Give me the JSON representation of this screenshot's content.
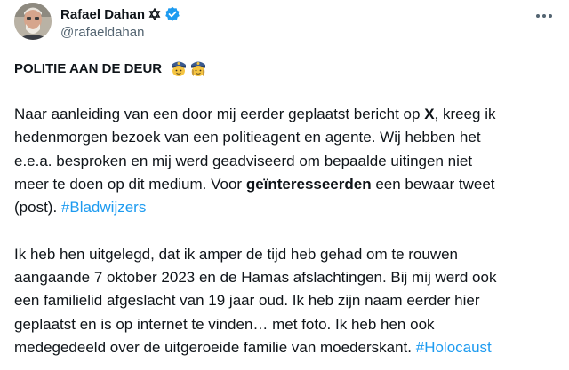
{
  "author": {
    "name": "Rafael Dahan",
    "handle": "@rafaeldahan",
    "badge_icons": [
      "star-of-david-icon",
      "verified-badge-icon"
    ],
    "verified_color": "#1d9bf0"
  },
  "menu": {
    "icon": "more-options-icon"
  },
  "tweet": {
    "headline": "POLITIE AAN DE DEUR",
    "headline_emojis": [
      "police-officer-icon",
      "police-officer-icon"
    ],
    "p1": {
      "l1a": "Naar aanleiding van een door mij eerder geplaatst bericht op ",
      "l1b": "X",
      "l1c": ", kreeg ik",
      "l2": "hedenmorgen bezoek van een politieagent en agente. Wij hebben het",
      "l3": "e.e.a. besproken en mij werd geadviseerd om bepaalde uitingen niet",
      "l4a": "meer te doen op dit medium. Voor ",
      "l4b": "geïnteresseerden",
      "l4c": " een bewaar tweet",
      "l5a": "(post). ",
      "l5b": "#Bladwijzers"
    },
    "p2": {
      "l1": "Ik heb hen uitgelegd, dat ik amper de tijd heb gehad om te rouwen",
      "l2": "aangaande 7 oktober 2023 en de Hamas afslachtingen. Bij mij werd ook",
      "l3": "een familielid afgeslacht van 19 jaar oud. Ik heb zijn naam eerder hier",
      "l4": "geplaatst en is op internet te vinden… met foto. Ik heb hen ook",
      "l5a": "medegedeeld over de uitgeroeide familie van moederskant. ",
      "l5b": "#Holocaust"
    },
    "hashtag_color": "#1d9bf0"
  }
}
